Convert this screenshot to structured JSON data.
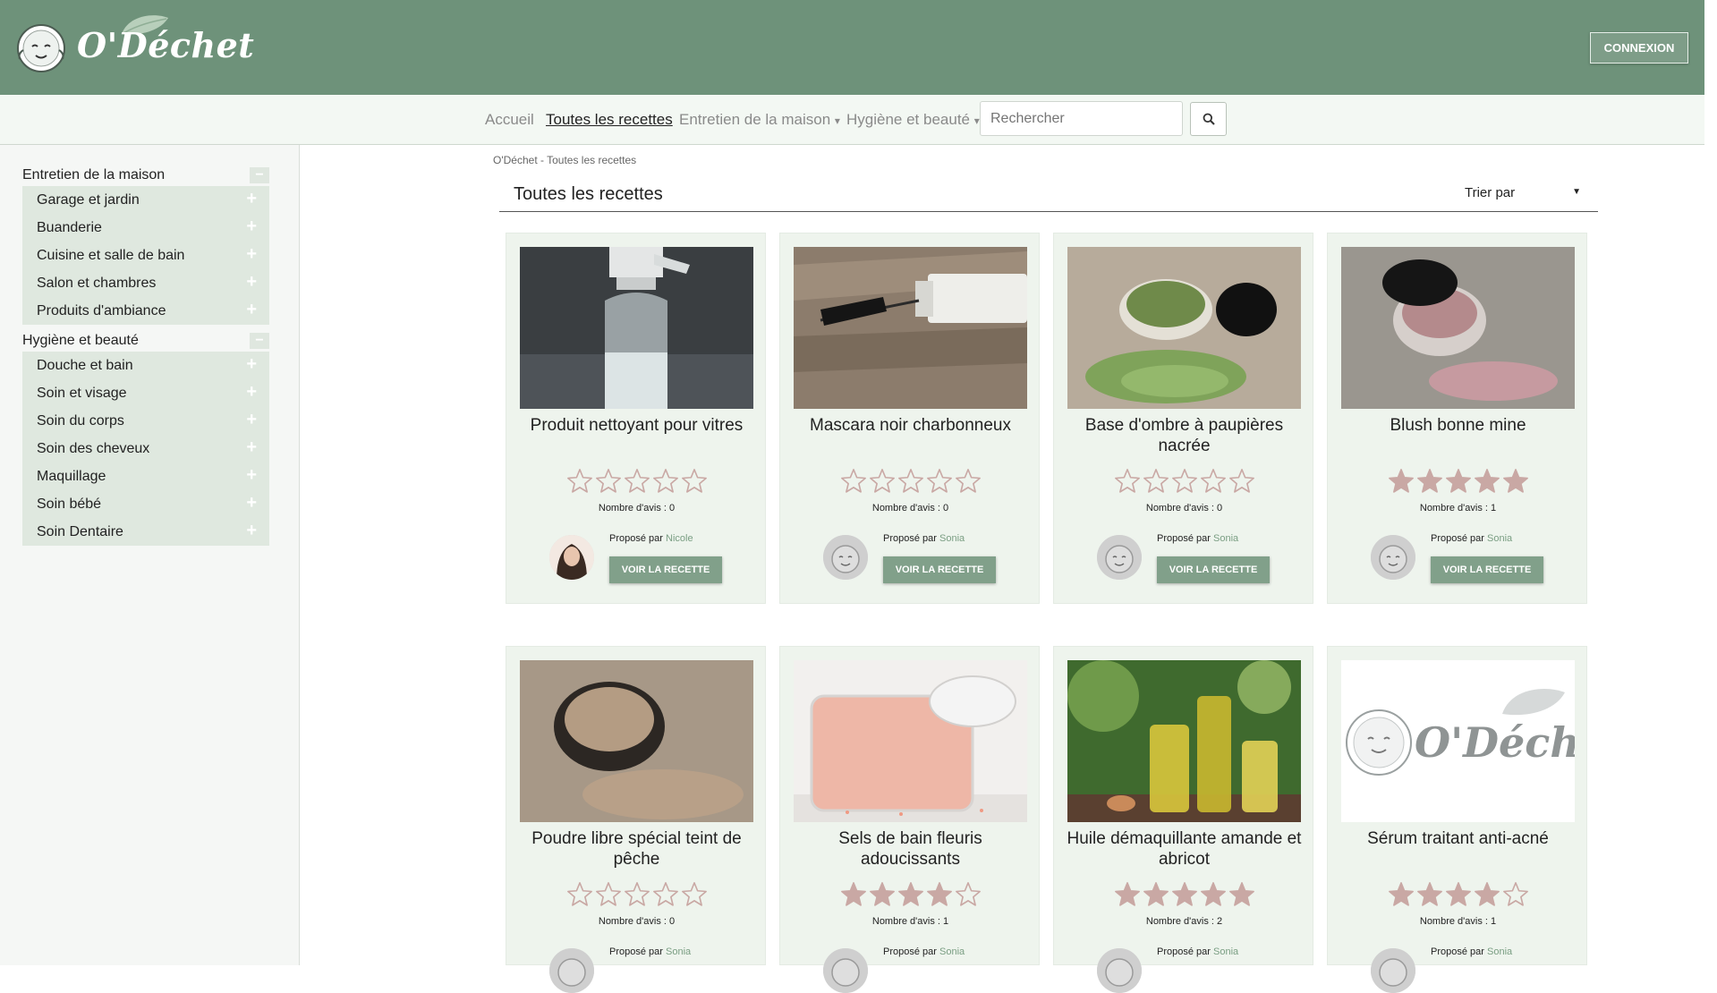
{
  "header": {
    "logo_text": "O'Déchet",
    "login_label": "CONNEXION"
  },
  "nav": {
    "items": [
      {
        "label": "Accueil"
      },
      {
        "label": "Toutes les recettes"
      },
      {
        "label": "Entretien de la maison"
      },
      {
        "label": "Hygiène et beauté"
      }
    ],
    "dropdown_caret": "▾",
    "search_placeholder": "Rechercher"
  },
  "sidebar": {
    "categories": [
      {
        "title": "Entretien de la maison",
        "toggle": "−",
        "items": [
          "Garage et jardin",
          "Buanderie",
          "Cuisine et salle de bain",
          "Salon et chambres",
          "Produits d'ambiance"
        ]
      },
      {
        "title": "Hygiène et beauté",
        "toggle": "−",
        "items": [
          "Douche et bain",
          "Soin et visage",
          "Soin du corps",
          "Soin des cheveux",
          "Maquillage",
          "Soin bébé",
          "Soin Dentaire"
        ]
      }
    ],
    "plus": "+"
  },
  "main": {
    "breadcrumb": "O'Déchet - Toutes les recettes",
    "title": "Toutes les recettes",
    "sort_label": "Trier par",
    "sort_caret": "▼",
    "proposed_prefix": "Proposé par",
    "view_label": "VOIR LA RECETTE",
    "cards": [
      {
        "title": "Produit nettoyant pour vitres",
        "rating": 0,
        "reviews": "Nombre d'avis : 0",
        "author": "Nicole",
        "image": "spray-bottle",
        "avatar": "woman-photo"
      },
      {
        "title": "Mascara noir charbonneux",
        "rating": 0,
        "reviews": "Nombre d'avis : 0",
        "author": "Sonia",
        "image": "mascara",
        "avatar": "mascot"
      },
      {
        "title": "Base d'ombre à paupières nacrée",
        "rating": 0,
        "reviews": "Nombre d'avis : 0",
        "author": "Sonia",
        "image": "green-powder-jar",
        "avatar": "mascot"
      },
      {
        "title": "Blush bonne mine",
        "rating": 5,
        "reviews": "Nombre d'avis : 1",
        "author": "Sonia",
        "image": "pink-powder-jar",
        "avatar": "mascot"
      },
      {
        "title": "Poudre libre spécial teint de pêche",
        "rating": 0,
        "reviews": "Nombre d'avis : 0",
        "author": "Sonia",
        "image": "beige-powder-jar",
        "avatar": "mascot"
      },
      {
        "title": "Sels de bain fleuris adoucissants",
        "rating": 4,
        "reviews": "Nombre d'avis : 1",
        "author": "Sonia",
        "image": "pink-salt-jar",
        "avatar": "mascot"
      },
      {
        "title": "Huile démaquillante amande et abricot",
        "rating": 5,
        "reviews": "Nombre d'avis : 2",
        "author": "Sonia",
        "image": "oil-bottles",
        "avatar": "mascot"
      },
      {
        "title": "Sérum traitant anti-acné",
        "rating": 4,
        "reviews": "Nombre d'avis : 1",
        "author": "Sonia",
        "image": "logo-placeholder",
        "avatar": "mascot"
      }
    ]
  },
  "colors": {
    "header_bg": "#6e927a",
    "nav_bg": "#f3f8f3",
    "card_bg": "#eef4ed",
    "accent": "#81a08a",
    "star": "#c9a8a4"
  }
}
